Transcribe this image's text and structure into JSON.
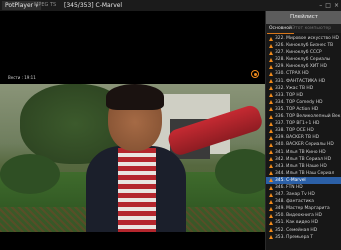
{
  "titlebar": {
    "app_menu": "PotPlayer",
    "file_label": "MPEG TS",
    "channel_title": "[345/353] C-Marvel",
    "window_buttons": [
      "–",
      "□",
      "×"
    ]
  },
  "video": {
    "caption": "Вести : 19:11"
  },
  "playlist": {
    "header": "Плейлист",
    "tabs": [
      "Основной",
      "Этот компьютер"
    ],
    "items": [
      "322. Мировое искусство HD",
      "326. Киноклуб Бизнес ТВ",
      "327. Киноклуб СССР",
      "328. Киноклуб Сериалы",
      "329. Киноклуб ХИТ HD",
      "330. СТРАХ HD",
      "331. ФАНТАСТИКА HD",
      "332. Ужас ТВ HD",
      "333. ТОР HD",
      "334. ТОР Comedy HD",
      "335. ТОР Action HD",
      "336. ТОР Великолепный Век HD",
      "337. ТОР ВГ1+1 HD",
      "338. ТОР ОСЕ HD",
      "339. BACKER ТВ HD",
      "340. BACKER Сериалы HD",
      "341. Илья ТВ Кино HD",
      "342. Илья ТВ Сериал HD",
      "343. Илья ТВ Наше HD",
      "344. Илья ТВ Наш Сериал",
      "345. С-Marvel",
      "346. FTN HD",
      "347. Занар Тv HD",
      "348. фантастика",
      "349. Мастер Маргарита",
      "350. Видеокнига HD",
      "351. Как видео HD",
      "352. Семейная HD",
      "353. Премьера Т"
    ],
    "selected_index": 20
  },
  "colors": {
    "accent": "#f08a1c",
    "selected": "#2b5fa6"
  }
}
